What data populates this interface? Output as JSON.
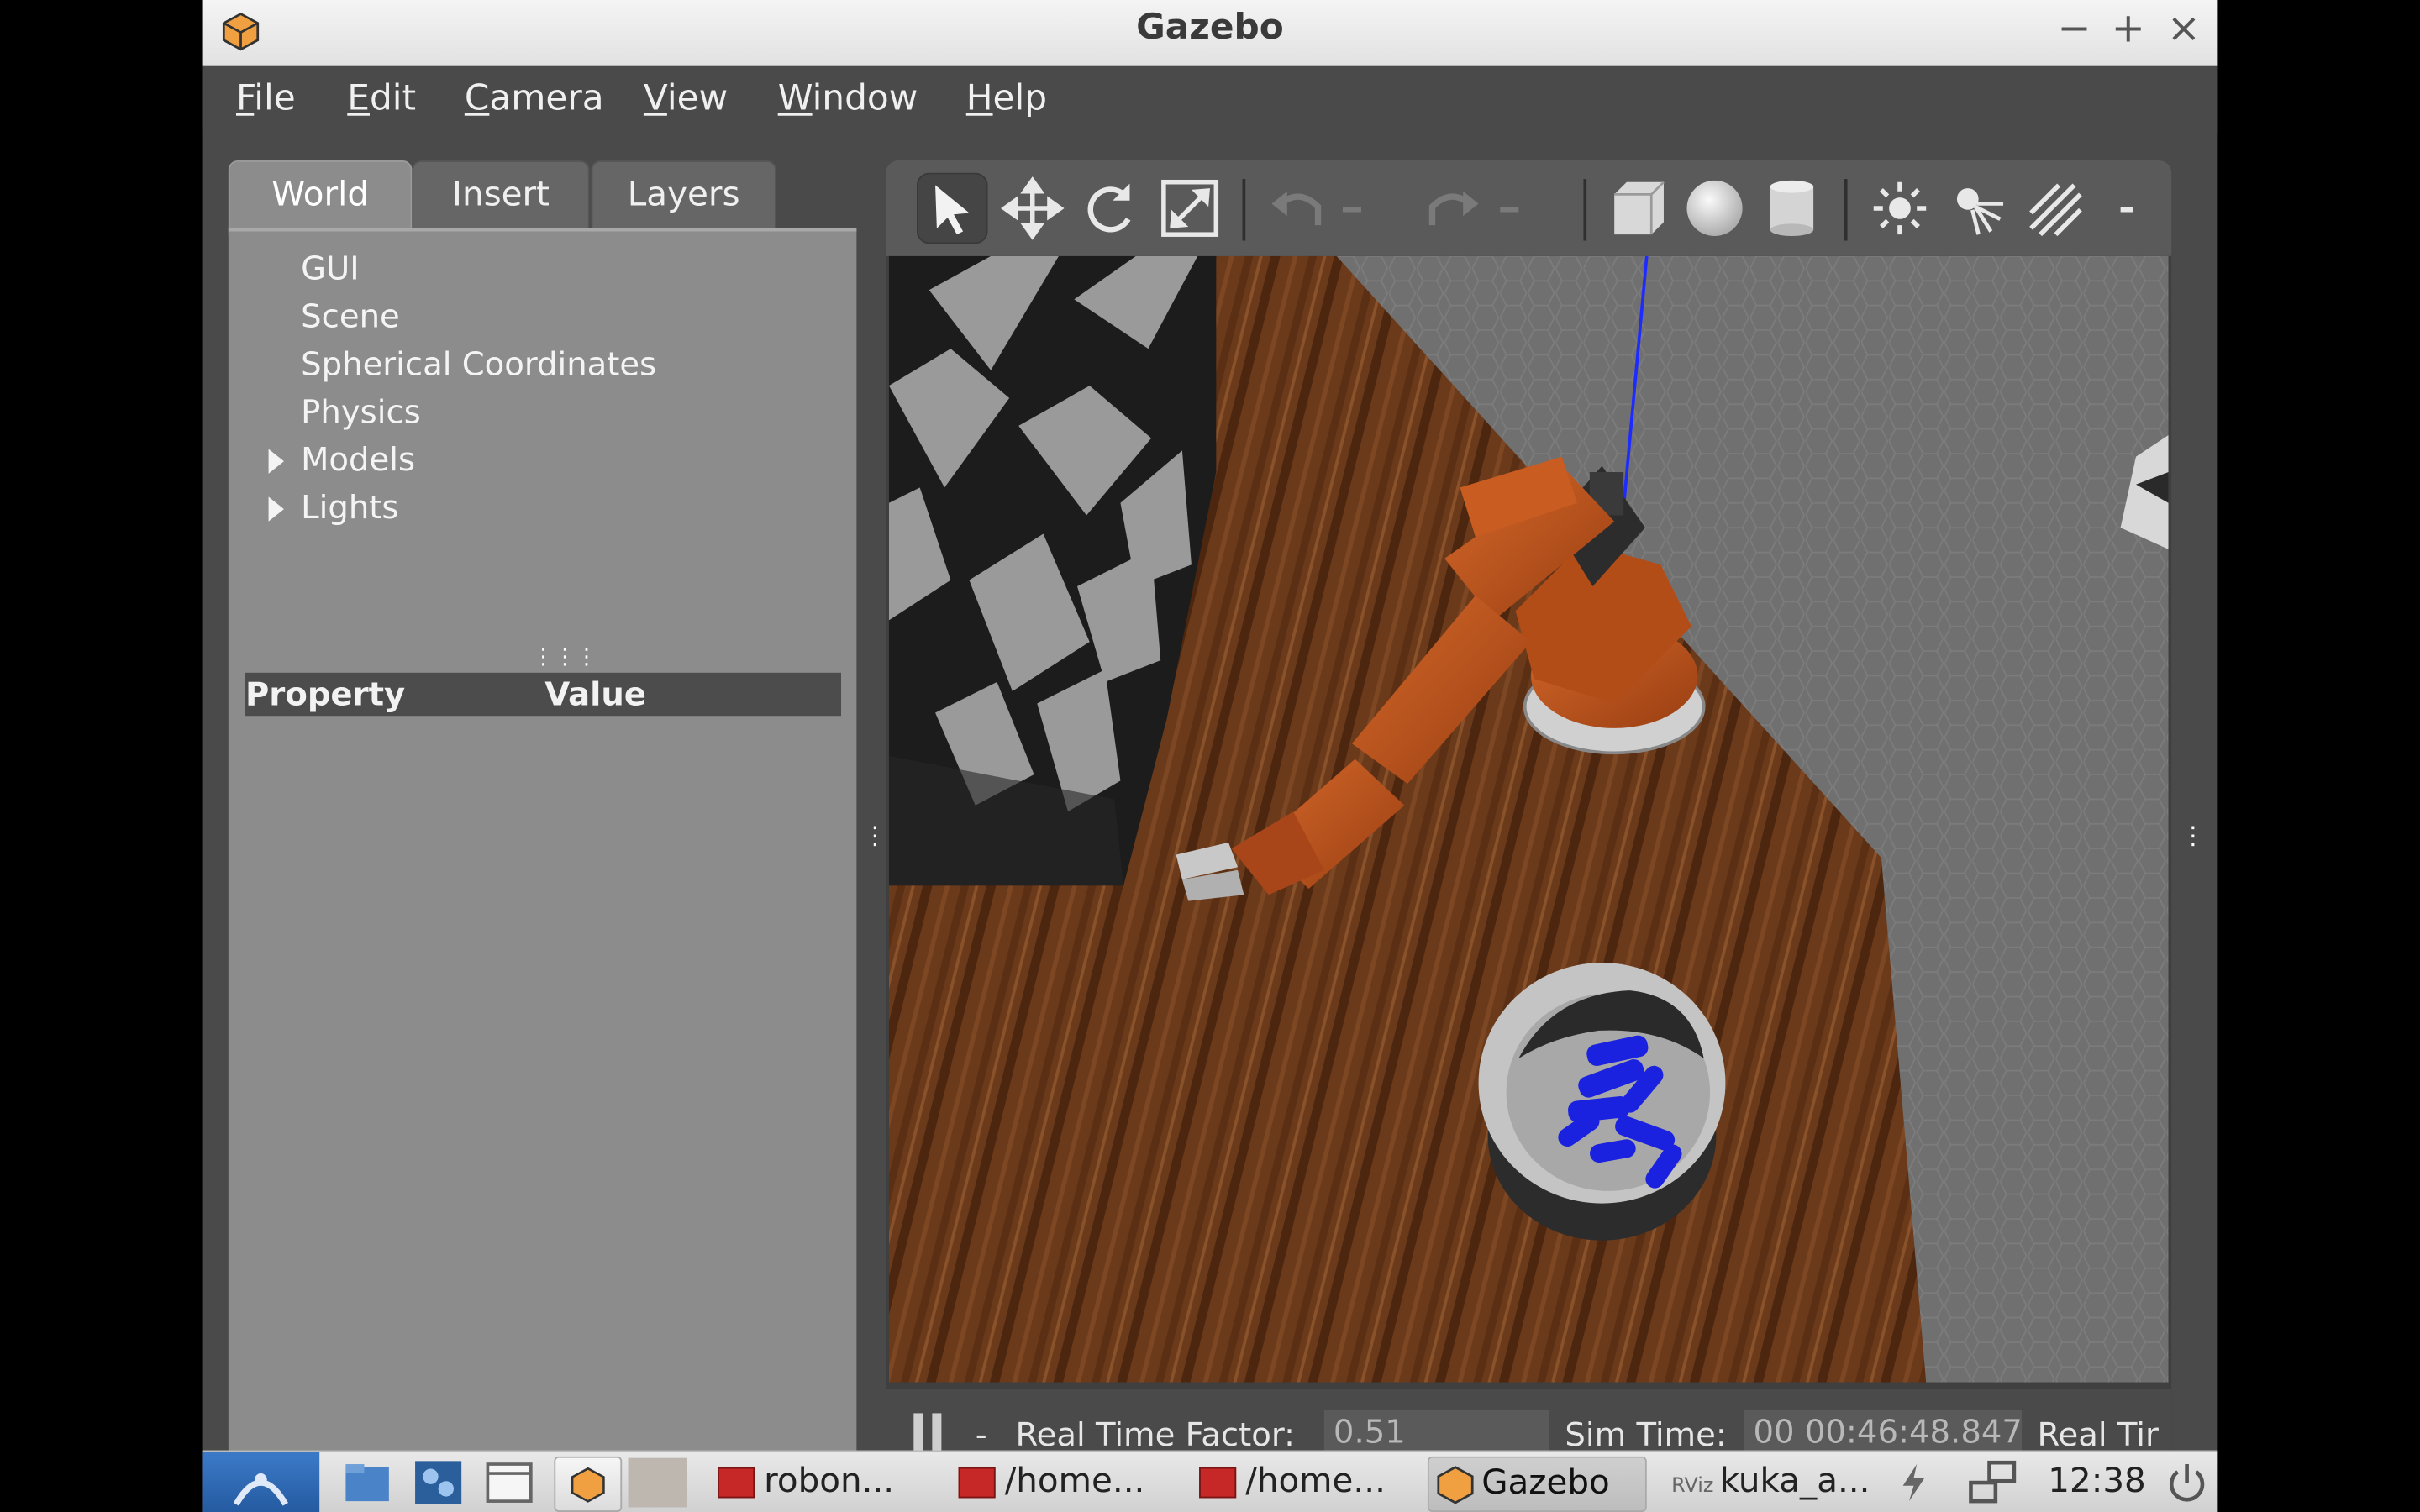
{
  "window": {
    "title": "Gazebo",
    "controls": {
      "minimize": "−",
      "maximize": "+",
      "close": "×"
    }
  },
  "menubar": [
    {
      "label": "File",
      "mnemonic": "F",
      "rest": "ile"
    },
    {
      "label": "Edit",
      "mnemonic": "E",
      "rest": "dit"
    },
    {
      "label": "Camera",
      "mnemonic": "C",
      "rest": "amera"
    },
    {
      "label": "View",
      "mnemonic": "V",
      "rest": "iew"
    },
    {
      "label": "Window",
      "mnemonic": "W",
      "rest": "indow"
    },
    {
      "label": "Help",
      "mnemonic": "H",
      "rest": "elp"
    }
  ],
  "left_panel": {
    "tabs": [
      {
        "label": "World",
        "active": true
      },
      {
        "label": "Insert"
      },
      {
        "label": "Layers"
      }
    ],
    "tree": [
      {
        "label": "GUI"
      },
      {
        "label": "Scene"
      },
      {
        "label": "Spherical Coordinates"
      },
      {
        "label": "Physics"
      },
      {
        "label": "Models",
        "expandable": true
      },
      {
        "label": "Lights",
        "expandable": true
      }
    ],
    "properties_header": {
      "property": "Property",
      "value": "Value"
    }
  },
  "toolbar": {
    "tools": [
      "select-arrow-icon",
      "translate-icon",
      "rotate-icon",
      "scale-icon",
      "undo-icon",
      "redo-icon",
      "box-shape-icon",
      "sphere-shape-icon",
      "cylinder-shape-icon",
      "point-light-icon",
      "spot-light-icon",
      "directional-light-icon"
    ],
    "selected": "select-arrow-icon"
  },
  "status": {
    "pause_icon": "pause-icon",
    "rtf_label": "Real Time Factor:",
    "rtf_value": "0.51",
    "sim_time_label": "Sim Time:",
    "sim_time_value": "00 00:46:48.847",
    "real_time_label": "Real Tir"
  },
  "taskbar": {
    "items": [
      {
        "label": "robon..."
      },
      {
        "label": "/home..."
      },
      {
        "label": "/home..."
      },
      {
        "label": "Gazebo",
        "active": true
      },
      {
        "label": "kuka_a..."
      }
    ],
    "clock": "12:38"
  },
  "colors": {
    "floor": "#6b3a1a",
    "robot": "#c8561e",
    "cylinders": "#1a22e0",
    "axis_line": "#1e2bff"
  }
}
